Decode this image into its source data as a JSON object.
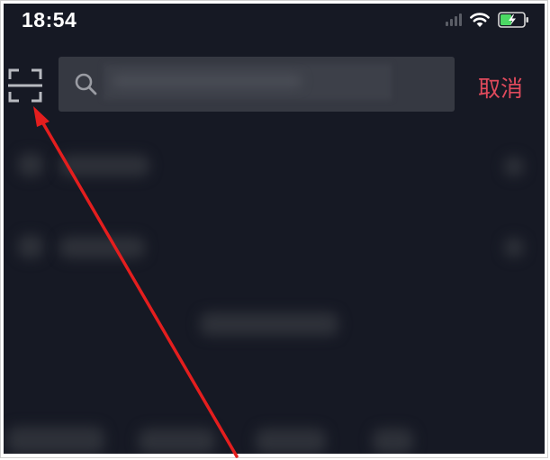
{
  "status_bar": {
    "time": "18:54"
  },
  "search": {
    "cancel_label": "取消"
  },
  "icons": {
    "scan": "scan-icon",
    "search": "search-icon",
    "wifi": "wifi-icon",
    "battery": "battery-charging-icon",
    "signal": "cellular-signal-icon"
  },
  "colors": {
    "background": "#161924",
    "search_box": "#363942",
    "cancel_text": "#e04a5c",
    "annotation_arrow": "#e41e1e",
    "battery_fill": "#4cd964"
  }
}
